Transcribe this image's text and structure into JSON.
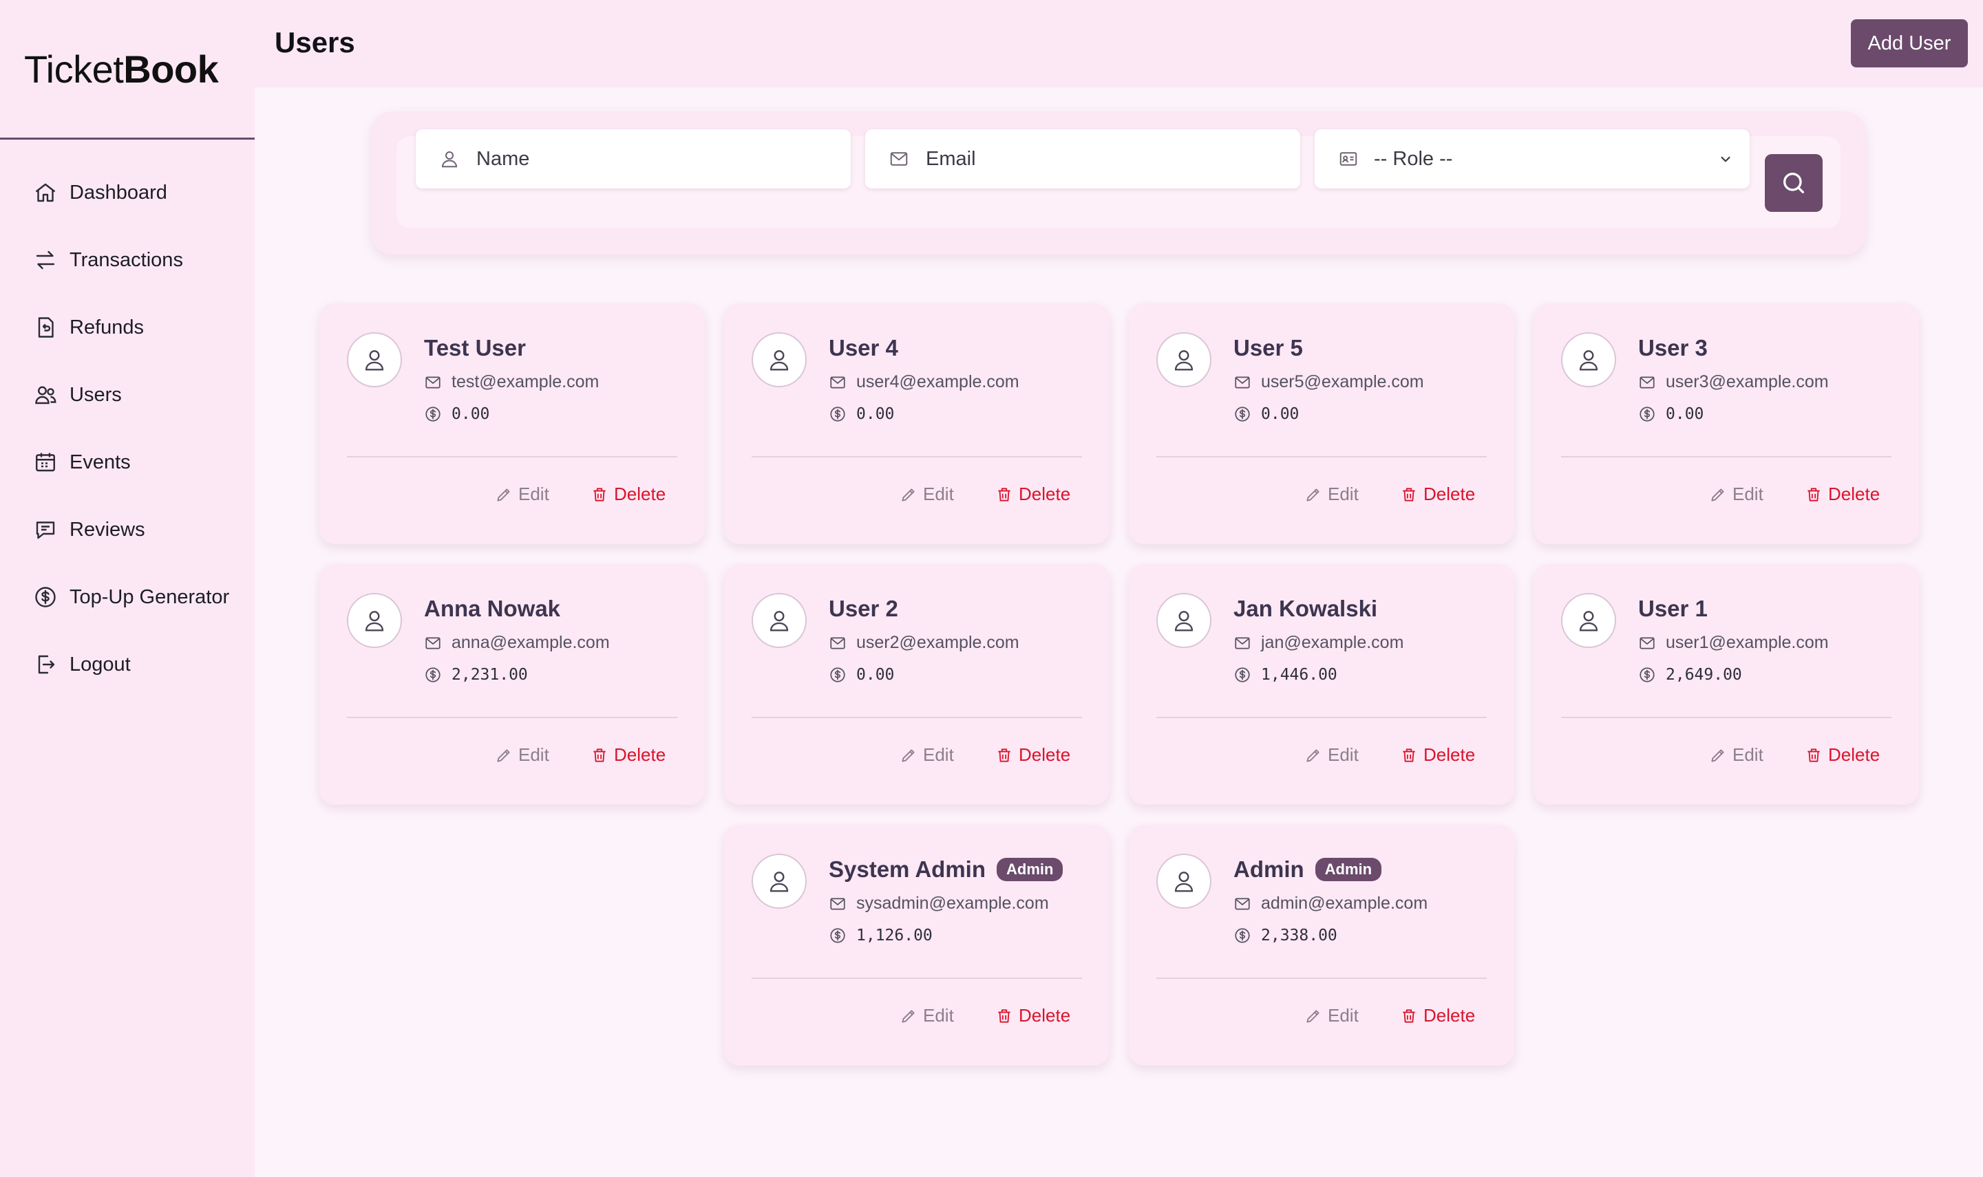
{
  "brand": {
    "light": "Ticket",
    "bold": "Book"
  },
  "sidebar": {
    "items": [
      {
        "label": "Dashboard",
        "icon": "home-icon"
      },
      {
        "label": "Transactions",
        "icon": "arrows-swap-icon"
      },
      {
        "label": "Refunds",
        "icon": "receipt-refund-icon"
      },
      {
        "label": "Users",
        "icon": "users-icon"
      },
      {
        "label": "Events",
        "icon": "calendar-icon"
      },
      {
        "label": "Reviews",
        "icon": "chat-icon"
      },
      {
        "label": "Top-Up Generator",
        "icon": "dollar-circle-icon"
      },
      {
        "label": "Logout",
        "icon": "logout-icon"
      }
    ]
  },
  "header": {
    "title": "Users",
    "add_button": "Add User"
  },
  "filters": {
    "name_placeholder": "Name",
    "email_placeholder": "Email",
    "role_selected": "-- Role --"
  },
  "users": [
    {
      "name": "Test User",
      "email": "test@example.com",
      "balance": "0.00",
      "badge": ""
    },
    {
      "name": "User 4",
      "email": "user4@example.com",
      "balance": "0.00",
      "badge": ""
    },
    {
      "name": "User 5",
      "email": "user5@example.com",
      "balance": "0.00",
      "badge": ""
    },
    {
      "name": "User 3",
      "email": "user3@example.com",
      "balance": "0.00",
      "badge": ""
    },
    {
      "name": "Anna Nowak",
      "email": "anna@example.com",
      "balance": "2,231.00",
      "badge": ""
    },
    {
      "name": "User 2",
      "email": "user2@example.com",
      "balance": "0.00",
      "badge": ""
    },
    {
      "name": "Jan Kowalski",
      "email": "jan@example.com",
      "balance": "1,446.00",
      "badge": ""
    },
    {
      "name": "User 1",
      "email": "user1@example.com",
      "balance": "2,649.00",
      "badge": ""
    },
    {
      "name": "System Admin",
      "email": "sysadmin@example.com",
      "balance": "1,126.00",
      "badge": "Admin"
    },
    {
      "name": "Admin",
      "email": "admin@example.com",
      "balance": "2,338.00",
      "badge": "Admin"
    }
  ],
  "card_actions": {
    "edit": "Edit",
    "delete": "Delete"
  },
  "colors": {
    "accent": "#6b4a6b",
    "danger": "#d9142b",
    "background": "#fdf3fa",
    "panel": "#fce8f5"
  }
}
